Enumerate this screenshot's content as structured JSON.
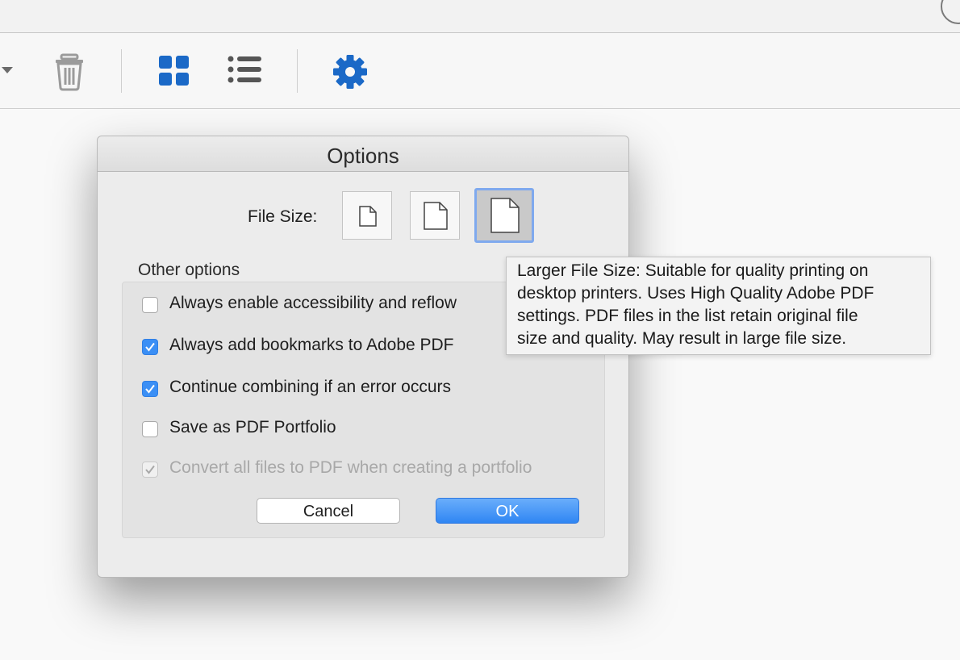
{
  "toolbar": {
    "icons": [
      "chevron-down-icon",
      "trash-icon",
      "grid-view-icon",
      "list-view-icon",
      "gear-icon"
    ],
    "accent_color": "#1b69c7"
  },
  "dialog": {
    "title": "Options",
    "file_size_label": "File Size:",
    "file_size_options": [
      "small",
      "medium",
      "large"
    ],
    "file_size_selected": "large",
    "other_options_label": "Other options",
    "options": [
      {
        "label": "Always enable accessibility and reflow",
        "checked": false,
        "enabled": true
      },
      {
        "label": "Always add bookmarks to Adobe PDF",
        "checked": true,
        "enabled": true
      },
      {
        "label": "Continue combining if an error occurs",
        "checked": true,
        "enabled": true
      },
      {
        "label": "Save as PDF Portfolio",
        "checked": false,
        "enabled": true
      },
      {
        "label": "Convert all files to PDF when creating a portfolio",
        "checked": true,
        "enabled": false
      }
    ],
    "cancel_label": "Cancel",
    "ok_label": "OK"
  },
  "tooltip": {
    "lines": [
      "Larger File Size: Suitable for quality printing on",
      "desktop printers. Uses High Quality Adobe PDF",
      "settings. PDF files in the list retain original file",
      "size and quality. May result in large file size."
    ]
  },
  "colors": {
    "checkbox_checked": "#3b8ff5",
    "ok_button": "#2f86f3",
    "selected_outline": "#7fa9ee"
  }
}
